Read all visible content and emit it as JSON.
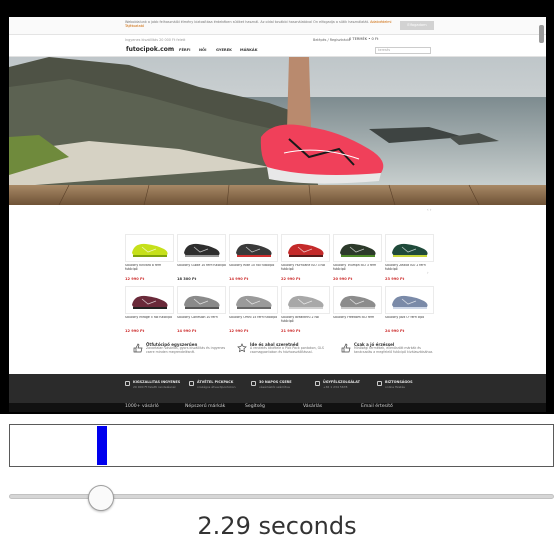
{
  "cookie_bar": {
    "text": "Weboldalunk a jobb felhasználói élmény biztosítása érdekében sütiket használ. Az oldal további használatával Ön elfogadja a sütik használatát.",
    "link": "Adatvédelmi Tájékoztató",
    "button": "Elfogadom"
  },
  "top_bar": {
    "left_text": "Ingyenes kiszállítás 20 000 Ft felett",
    "right_text": "Belépés / Regisztráció",
    "cart_text": "0 TERMÉK • 0 Ft"
  },
  "nav": {
    "logo": "futocipok.com",
    "items": [
      "FÉRFI",
      "NŐI",
      "GYEREK",
      "MÁRKÁK"
    ],
    "search_placeholder": "keresés"
  },
  "products": [
    {
      "name": "Saucony Kinvara 8 férfi futócipő",
      "old": "",
      "price": "12 990 Ft",
      "color": "#c6e01a",
      "accent": "#7fa30a"
    },
    {
      "name": "Saucony Guide 10 férfi futócipő",
      "old": "",
      "price": "18 300 Ft",
      "color": "#2e2e2e",
      "accent": "#999999"
    },
    {
      "name": "Saucony Ride 10 női futócipő",
      "old": "",
      "price": "14 990 Ft",
      "color": "#3a3a3a",
      "accent": "#d03030"
    },
    {
      "name": "Saucony Hurricane ISO 3 női futócipő",
      "old": "",
      "price": "22 990 Ft",
      "color": "#c42a2a",
      "accent": "#5a1a1a"
    },
    {
      "name": "Saucony Triumph ISO 3 férfi futócipő",
      "old": "",
      "price": "20 990 Ft",
      "color": "#2c3a2a",
      "accent": "#4e8a2a"
    },
    {
      "name": "Saucony Zealot ISO 2 férfi futócipő",
      "old": "",
      "price": "23 990 Ft",
      "color": "#1f4a3a",
      "accent": "#c7d63a"
    },
    {
      "name": "Saucony Mirage 5 női futócipő",
      "old": "",
      "price": "12 990 Ft",
      "color": "#6a2a3a",
      "accent": "#222222"
    },
    {
      "name": "Saucony Cohesion 10 férfi",
      "old": "",
      "price": "14 990 Ft",
      "color": "#8a8a8a",
      "accent": "#555555"
    },
    {
      "name": "Saucony Omni 15 férfi futócipő",
      "old": "",
      "price": "12 990 Ft",
      "color": "#9a9a9a",
      "accent": "#666666"
    },
    {
      "name": "Saucony Breakthru 2 női futócipő",
      "old": "",
      "price": "21 990 Ft",
      "color": "#a8a8a8",
      "accent": "#d0d0d0"
    },
    {
      "name": "Saucony Freedom ISO férfi",
      "old": "",
      "price": "",
      "color": "#8c8c8c",
      "accent": "#c8c8c8"
    },
    {
      "name": "Saucony Jazz O' férfi cipő",
      "old": "",
      "price": "24 990 Ft",
      "color": "#7a8aa8",
      "accent": "#cfd8e8"
    }
  ],
  "features": [
    {
      "title": "Ötfutócipő egyszerűen",
      "desc": "Zavartalan vásárlás, gyors kiszállítás és ingyenes csere minden megrendelésnél."
    },
    {
      "title": "Ide és ahol szeretnéd",
      "desc": "A rendelés átvétele a Pick Pack pontokon, GLS csomagpontokon és házhozszállítással."
    },
    {
      "title": "Csak a jó érzéssel",
      "desc": "Minőségi termékek, ellenőrzött márkák és tanácsadás a megfelelő futócipő kiválasztásához."
    }
  ],
  "footer": {
    "items": [
      {
        "label": "KIGSZALLITAS INGYENES",
        "sub": "20 000 Ft feletti rendelésnél"
      },
      {
        "label": "ÁTVÉTEL PICKPACK",
        "sub": "országos átvevőpontokon"
      },
      {
        "label": "30 NAPOS CSERE",
        "sub": "vásárlástól számítva"
      },
      {
        "label": "ÜGYFÉLSZOLGÁLAT",
        "sub": "+36 1 234 5678"
      },
      {
        "label": "BIZTONSÁGOS",
        "sub": "online fizetés"
      }
    ],
    "links": [
      "1000+ vásárló",
      "Népszerű márkák",
      "Segítség",
      "Vásárlás",
      "Email értesítő"
    ]
  },
  "player": {
    "time_label": "2.29 seconds"
  }
}
